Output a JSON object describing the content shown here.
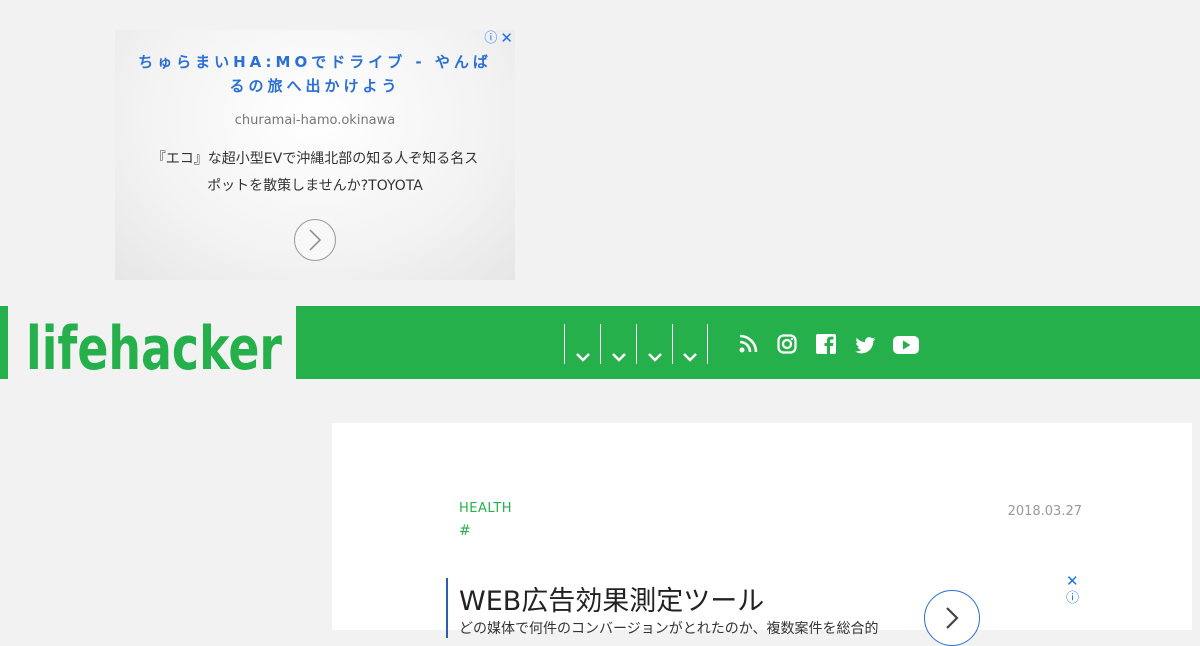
{
  "top_ad": {
    "title": "ちゅらまいHA:MOでドライブ - やんばるの旅へ出かけよう",
    "domain": "churamai-hamo.okinawa",
    "description": "『エコ』な超小型EVで沖縄北部の知る人ぞ知る名スポットを散策しませんか?TOYOTA",
    "info_icon": "info-icon",
    "close_icon": "close-icon",
    "accent_color": "#2a6fd6"
  },
  "header": {
    "logo_text": "lifehacker",
    "brand_color": "#26b04c",
    "nav_items": 4,
    "social_icons": [
      "rss-icon",
      "instagram-icon",
      "facebook-icon",
      "twitter-icon",
      "youtube-icon"
    ]
  },
  "article": {
    "category": "HEALTH",
    "tag": "#",
    "date": "2018.03.27"
  },
  "inline_ad": {
    "title": "WEB広告効果測定ツール",
    "description": "どの媒体で何件のコンバージョンがとれたのか、複数案件を総合的"
  }
}
